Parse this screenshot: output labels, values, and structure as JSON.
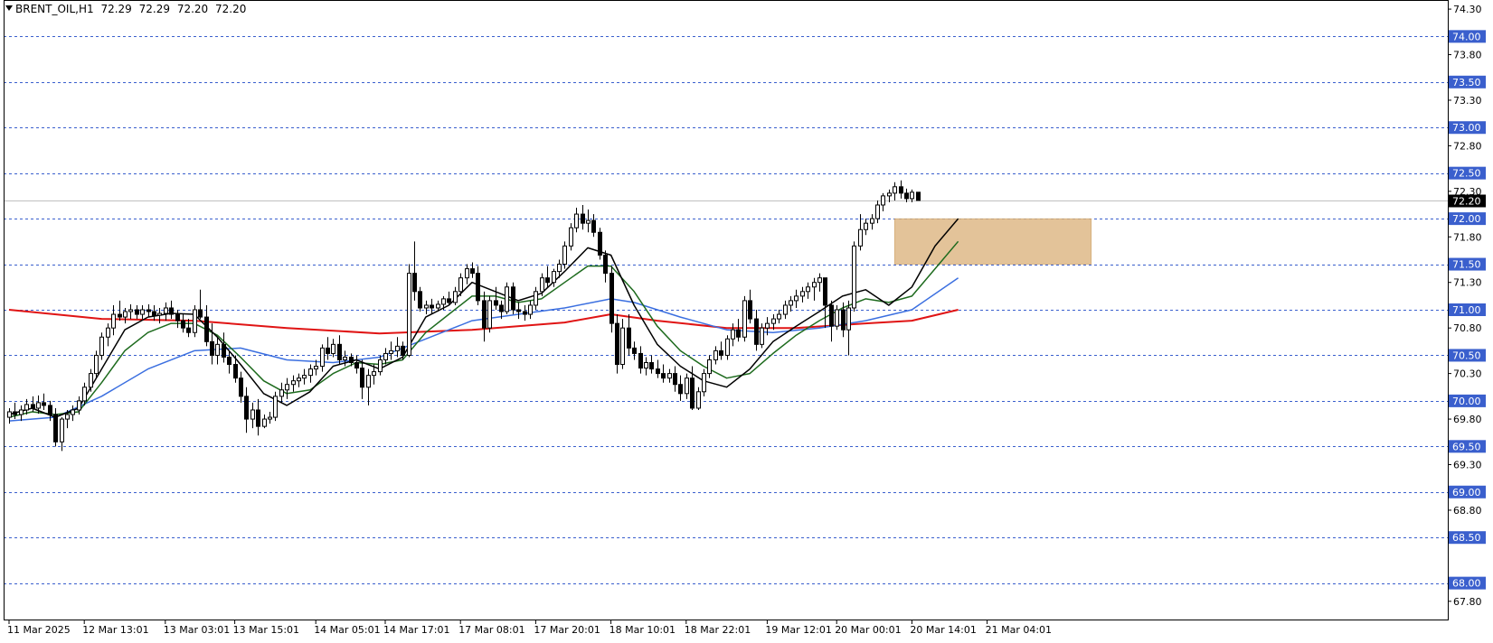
{
  "header": {
    "symbol": "BRENT_OIL,H1",
    "open": "72.29",
    "high": "72.29",
    "low": "72.20",
    "close": "72.20"
  },
  "colors": {
    "background": "#ffffff",
    "grid_level": "#3a5fcd",
    "label_box": "#3a5fcd",
    "price_box": "#000000",
    "bull_candle": "#ffffff",
    "bear_candle": "#000000",
    "ma_fast": "#000000",
    "ma_mid": "#1e6b1e",
    "ma_slow": "#3b6fe0",
    "ma_long": "#e01414",
    "zone": "#deb887"
  },
  "chart_data": {
    "type": "candlestick",
    "timeframe": "H1",
    "ylim": [
      67.6,
      74.4
    ],
    "y_ticks": [
      "74.30",
      "73.80",
      "73.30",
      "72.80",
      "72.30",
      "71.80",
      "71.30",
      "70.80",
      "70.30",
      "69.80",
      "69.30",
      "68.80",
      "67.80"
    ],
    "level_labels": [
      "74.00",
      "73.50",
      "73.00",
      "72.50",
      "72.00",
      "71.50",
      "71.00",
      "70.50",
      "70.00",
      "69.50",
      "69.00",
      "68.50",
      "68.00"
    ],
    "level_values": [
      74.0,
      73.5,
      73.0,
      72.5,
      72.0,
      71.5,
      71.0,
      70.5,
      70.0,
      69.5,
      69.0,
      68.5,
      68.0
    ],
    "current_price": "72.20",
    "x_labels": [
      "11 Mar 2025",
      "12 Mar 13:01",
      "13 Mar 03:01",
      "13 Mar 15:01",
      "14 Mar 05:01",
      "14 Mar 17:01",
      "17 Mar 08:01",
      "17 Mar 20:01",
      "18 Mar 10:01",
      "18 Mar 22:01",
      "19 Mar 12:01",
      "20 Mar 00:01",
      "20 Mar 14:01",
      "21 Mar 04:01"
    ],
    "x_label_bars": [
      0,
      13,
      27,
      39,
      53,
      65,
      78,
      91,
      104,
      117,
      131,
      143,
      156,
      169
    ],
    "zone": {
      "bar_from": 153,
      "bar_to": 187,
      "from": 71.5,
      "to": 72.0
    },
    "ohlc": [
      [
        69.82,
        69.92,
        69.75,
        69.88
      ],
      [
        69.88,
        69.98,
        69.8,
        69.85
      ],
      [
        69.85,
        69.95,
        69.78,
        69.9
      ],
      [
        69.9,
        70.02,
        69.85,
        69.96
      ],
      [
        69.96,
        70.05,
        69.88,
        69.92
      ],
      [
        69.92,
        70.06,
        69.86,
        69.98
      ],
      [
        69.98,
        70.08,
        69.9,
        69.95
      ],
      [
        69.95,
        70.0,
        69.78,
        69.85
      ],
      [
        69.85,
        69.92,
        69.5,
        69.55
      ],
      [
        69.55,
        69.82,
        69.45,
        69.8
      ],
      [
        69.8,
        69.9,
        69.7,
        69.85
      ],
      [
        69.85,
        69.95,
        69.78,
        69.9
      ],
      [
        69.9,
        70.05,
        69.85,
        70.0
      ],
      [
        70.0,
        70.2,
        69.95,
        70.15
      ],
      [
        70.15,
        70.35,
        70.1,
        70.3
      ],
      [
        70.3,
        70.55,
        70.25,
        70.5
      ],
      [
        70.5,
        70.75,
        70.45,
        70.7
      ],
      [
        70.7,
        70.85,
        70.6,
        70.8
      ],
      [
        70.8,
        71.05,
        70.72,
        70.95
      ],
      [
        70.95,
        71.1,
        70.88,
        70.92
      ],
      [
        70.92,
        71.02,
        70.85,
        70.98
      ],
      [
        70.98,
        71.06,
        70.9,
        71.0
      ],
      [
        71.0,
        71.05,
        70.9,
        70.95
      ],
      [
        70.95,
        71.05,
        70.9,
        71.0
      ],
      [
        71.0,
        71.06,
        70.92,
        70.98
      ],
      [
        70.98,
        71.05,
        70.88,
        70.94
      ],
      [
        70.94,
        71.02,
        70.85,
        70.96
      ],
      [
        70.96,
        71.08,
        70.88,
        71.02
      ],
      [
        71.02,
        71.1,
        70.9,
        70.95
      ],
      [
        70.95,
        71.0,
        70.8,
        70.88
      ],
      [
        70.88,
        70.95,
        70.75,
        70.8
      ],
      [
        70.8,
        70.9,
        70.7,
        70.75
      ],
      [
        70.75,
        71.05,
        70.7,
        71.0
      ],
      [
        71.0,
        71.22,
        70.9,
        70.92
      ],
      [
        70.92,
        71.05,
        70.6,
        70.65
      ],
      [
        70.65,
        70.85,
        70.4,
        70.5
      ],
      [
        70.5,
        70.7,
        70.4,
        70.62
      ],
      [
        70.62,
        70.75,
        70.42,
        70.48
      ],
      [
        70.48,
        70.55,
        70.3,
        70.4
      ],
      [
        70.4,
        70.5,
        70.2,
        70.25
      ],
      [
        70.25,
        70.32,
        69.98,
        70.05
      ],
      [
        70.05,
        70.15,
        69.65,
        69.8
      ],
      [
        69.8,
        69.98,
        69.7,
        69.9
      ],
      [
        69.9,
        70.02,
        69.62,
        69.72
      ],
      [
        69.72,
        69.85,
        69.7,
        69.8
      ],
      [
        69.8,
        69.88,
        69.75,
        69.82
      ],
      [
        69.82,
        70.1,
        69.78,
        70.05
      ],
      [
        70.05,
        70.2,
        69.98,
        70.12
      ],
      [
        70.12,
        70.25,
        70.02,
        70.18
      ],
      [
        70.18,
        70.28,
        70.1,
        70.22
      ],
      [
        70.22,
        70.3,
        70.15,
        70.25
      ],
      [
        70.25,
        70.35,
        70.18,
        70.28
      ],
      [
        70.28,
        70.4,
        70.2,
        70.35
      ],
      [
        70.35,
        70.45,
        70.28,
        70.38
      ],
      [
        70.38,
        70.62,
        70.32,
        70.58
      ],
      [
        70.58,
        70.7,
        70.45,
        70.52
      ],
      [
        70.52,
        70.68,
        70.48,
        70.62
      ],
      [
        70.62,
        70.72,
        70.4,
        70.45
      ],
      [
        70.45,
        70.55,
        70.38,
        70.48
      ],
      [
        70.48,
        70.52,
        70.38,
        70.42
      ],
      [
        70.42,
        70.5,
        70.3,
        70.36
      ],
      [
        70.36,
        70.45,
        70.02,
        70.15
      ],
      [
        70.15,
        70.35,
        69.95,
        70.28
      ],
      [
        70.28,
        70.4,
        70.18,
        70.32
      ],
      [
        70.32,
        70.5,
        70.28,
        70.45
      ],
      [
        70.45,
        70.58,
        70.4,
        70.52
      ],
      [
        70.52,
        70.65,
        70.45,
        70.55
      ],
      [
        70.55,
        70.7,
        70.48,
        70.6
      ],
      [
        70.6,
        70.65,
        70.45,
        70.5
      ],
      [
        70.5,
        71.5,
        70.48,
        71.4
      ],
      [
        71.4,
        71.75,
        71.1,
        71.2
      ],
      [
        71.2,
        71.25,
        70.98,
        71.02
      ],
      [
        71.02,
        71.1,
        70.95,
        71.05
      ],
      [
        71.05,
        71.12,
        70.95,
        71.02
      ],
      [
        71.02,
        71.1,
        70.98,
        71.06
      ],
      [
        71.06,
        71.15,
        71.0,
        71.12
      ],
      [
        71.12,
        71.2,
        71.05,
        71.08
      ],
      [
        71.08,
        71.25,
        71.05,
        71.2
      ],
      [
        71.2,
        71.4,
        71.15,
        71.35
      ],
      [
        71.35,
        71.5,
        71.28,
        71.45
      ],
      [
        71.45,
        71.52,
        71.35,
        71.4
      ],
      [
        71.4,
        71.48,
        71.05,
        71.1
      ],
      [
        71.1,
        71.2,
        70.65,
        70.8
      ],
      [
        70.8,
        71.15,
        70.75,
        71.1
      ],
      [
        71.1,
        71.25,
        71.0,
        71.05
      ],
      [
        71.05,
        71.1,
        70.9,
        70.98
      ],
      [
        70.98,
        71.3,
        70.95,
        71.25
      ],
      [
        71.25,
        71.3,
        70.95,
        71.0
      ],
      [
        71.0,
        71.08,
        70.9,
        70.98
      ],
      [
        70.98,
        71.05,
        70.88,
        70.95
      ],
      [
        70.95,
        71.1,
        70.9,
        71.05
      ],
      [
        71.05,
        71.25,
        71.0,
        71.2
      ],
      [
        71.2,
        71.4,
        71.15,
        71.35
      ],
      [
        71.35,
        71.48,
        71.25,
        71.3
      ],
      [
        71.3,
        71.45,
        71.25,
        71.42
      ],
      [
        71.42,
        71.55,
        71.35,
        71.5
      ],
      [
        71.5,
        71.75,
        71.45,
        71.7
      ],
      [
        71.7,
        71.95,
        71.65,
        71.9
      ],
      [
        71.9,
        72.12,
        71.85,
        72.05
      ],
      [
        72.05,
        72.15,
        71.88,
        71.95
      ],
      [
        71.95,
        72.1,
        71.85,
        71.98
      ],
      [
        71.98,
        72.05,
        71.8,
        71.85
      ],
      [
        71.85,
        71.9,
        71.55,
        71.6
      ],
      [
        71.6,
        71.65,
        71.3,
        71.4
      ],
      [
        71.4,
        71.48,
        70.75,
        70.85
      ],
      [
        70.85,
        70.95,
        70.3,
        70.4
      ],
      [
        70.4,
        70.9,
        70.35,
        70.8
      ],
      [
        70.8,
        70.95,
        70.5,
        70.58
      ],
      [
        70.58,
        70.65,
        70.45,
        70.52
      ],
      [
        70.52,
        70.6,
        70.3,
        70.36
      ],
      [
        70.36,
        70.48,
        70.28,
        70.42
      ],
      [
        70.42,
        70.5,
        70.3,
        70.35
      ],
      [
        70.35,
        70.45,
        70.25,
        70.3
      ],
      [
        70.3,
        70.4,
        70.2,
        70.25
      ],
      [
        70.25,
        70.35,
        70.2,
        70.3
      ],
      [
        70.3,
        70.38,
        70.1,
        70.18
      ],
      [
        70.18,
        70.28,
        70.0,
        70.08
      ],
      [
        70.08,
        70.3,
        70.02,
        70.25
      ],
      [
        70.25,
        70.38,
        69.9,
        69.92
      ],
      [
        69.92,
        70.15,
        69.9,
        70.1
      ],
      [
        70.1,
        70.35,
        70.05,
        70.3
      ],
      [
        70.3,
        70.5,
        70.25,
        70.45
      ],
      [
        70.45,
        70.6,
        70.4,
        70.55
      ],
      [
        70.55,
        70.65,
        70.45,
        70.5
      ],
      [
        70.5,
        70.72,
        70.45,
        70.68
      ],
      [
        70.68,
        70.85,
        70.6,
        70.78
      ],
      [
        70.78,
        70.9,
        70.65,
        70.7
      ],
      [
        70.7,
        71.15,
        70.65,
        71.1
      ],
      [
        71.1,
        71.22,
        70.85,
        70.9
      ],
      [
        70.9,
        71.0,
        70.55,
        70.62
      ],
      [
        70.62,
        70.85,
        70.58,
        70.8
      ],
      [
        70.8,
        70.92,
        70.72,
        70.85
      ],
      [
        70.85,
        70.95,
        70.78,
        70.9
      ],
      [
        70.9,
        71.0,
        70.85,
        70.95
      ],
      [
        70.95,
        71.1,
        70.9,
        71.05
      ],
      [
        71.05,
        71.15,
        70.98,
        71.1
      ],
      [
        71.1,
        71.22,
        71.02,
        71.15
      ],
      [
        71.15,
        71.25,
        71.08,
        71.2
      ],
      [
        71.2,
        71.3,
        71.12,
        71.25
      ],
      [
        71.25,
        71.35,
        71.1,
        71.3
      ],
      [
        71.3,
        71.4,
        71.2,
        71.35
      ],
      [
        71.35,
        71.2,
        70.8,
        71.05
      ],
      [
        71.05,
        71.1,
        70.65,
        70.82
      ],
      [
        70.82,
        71.05,
        70.78,
        71.0
      ],
      [
        71.0,
        71.08,
        70.7,
        70.78
      ],
      [
        70.78,
        71.1,
        70.5,
        71.02
      ],
      [
        71.02,
        71.75,
        70.98,
        71.7
      ],
      [
        71.7,
        72.05,
        71.65,
        71.88
      ],
      [
        71.88,
        72.0,
        71.82,
        71.95
      ],
      [
        71.95,
        72.05,
        71.88,
        72.0
      ],
      [
        72.0,
        72.2,
        71.95,
        72.15
      ],
      [
        72.15,
        72.28,
        72.08,
        72.25
      ],
      [
        72.25,
        72.32,
        72.18,
        72.28
      ],
      [
        72.28,
        72.4,
        72.2,
        72.35
      ],
      [
        72.35,
        72.42,
        72.22,
        72.28
      ],
      [
        72.28,
        72.33,
        72.18,
        72.22
      ],
      [
        72.22,
        72.32,
        72.18,
        72.29
      ],
      [
        72.29,
        72.29,
        72.2,
        72.2
      ]
    ],
    "ma_fast": [
      [
        0,
        69.85
      ],
      [
        4,
        69.92
      ],
      [
        8,
        69.82
      ],
      [
        12,
        69.92
      ],
      [
        16,
        70.35
      ],
      [
        20,
        70.78
      ],
      [
        24,
        70.92
      ],
      [
        28,
        70.96
      ],
      [
        32,
        70.95
      ],
      [
        36,
        70.7
      ],
      [
        40,
        70.4
      ],
      [
        44,
        70.08
      ],
      [
        48,
        69.95
      ],
      [
        52,
        70.1
      ],
      [
        56,
        70.38
      ],
      [
        60,
        70.45
      ],
      [
        64,
        70.35
      ],
      [
        68,
        70.48
      ],
      [
        72,
        70.92
      ],
      [
        76,
        71.05
      ],
      [
        80,
        71.3
      ],
      [
        84,
        71.2
      ],
      [
        88,
        71.1
      ],
      [
        92,
        71.18
      ],
      [
        96,
        71.42
      ],
      [
        100,
        71.68
      ],
      [
        104,
        71.6
      ],
      [
        108,
        71.05
      ],
      [
        112,
        70.62
      ],
      [
        116,
        70.38
      ],
      [
        120,
        70.22
      ],
      [
        124,
        70.15
      ],
      [
        128,
        70.35
      ],
      [
        132,
        70.65
      ],
      [
        136,
        70.82
      ],
      [
        140,
        70.98
      ],
      [
        144,
        71.15
      ],
      [
        148,
        71.22
      ],
      [
        152,
        71.05
      ],
      [
        156,
        71.25
      ],
      [
        160,
        71.7
      ],
      [
        164,
        72.0
      ]
    ],
    "ma_mid": [
      [
        0,
        69.82
      ],
      [
        4,
        69.88
      ],
      [
        8,
        69.85
      ],
      [
        12,
        69.88
      ],
      [
        16,
        70.2
      ],
      [
        20,
        70.55
      ],
      [
        24,
        70.75
      ],
      [
        28,
        70.85
      ],
      [
        32,
        70.85
      ],
      [
        36,
        70.72
      ],
      [
        40,
        70.48
      ],
      [
        44,
        70.22
      ],
      [
        48,
        70.08
      ],
      [
        52,
        70.12
      ],
      [
        56,
        70.3
      ],
      [
        60,
        70.42
      ],
      [
        64,
        70.4
      ],
      [
        68,
        70.45
      ],
      [
        72,
        70.75
      ],
      [
        76,
        70.95
      ],
      [
        80,
        71.15
      ],
      [
        84,
        71.15
      ],
      [
        88,
        71.08
      ],
      [
        92,
        71.12
      ],
      [
        96,
        71.3
      ],
      [
        100,
        71.48
      ],
      [
        104,
        71.48
      ],
      [
        108,
        71.2
      ],
      [
        112,
        70.82
      ],
      [
        116,
        70.55
      ],
      [
        120,
        70.38
      ],
      [
        124,
        70.25
      ],
      [
        128,
        70.3
      ],
      [
        132,
        70.52
      ],
      [
        136,
        70.72
      ],
      [
        140,
        70.88
      ],
      [
        144,
        71.02
      ],
      [
        148,
        71.12
      ],
      [
        152,
        71.08
      ],
      [
        156,
        71.15
      ],
      [
        160,
        71.45
      ],
      [
        164,
        71.75
      ]
    ],
    "ma_slow": [
      [
        0,
        69.78
      ],
      [
        8,
        69.82
      ],
      [
        16,
        70.05
      ],
      [
        24,
        70.35
      ],
      [
        32,
        70.55
      ],
      [
        40,
        70.58
      ],
      [
        48,
        70.45
      ],
      [
        56,
        70.42
      ],
      [
        64,
        70.48
      ],
      [
        72,
        70.68
      ],
      [
        80,
        70.88
      ],
      [
        88,
        70.95
      ],
      [
        96,
        71.02
      ],
      [
        104,
        71.12
      ],
      [
        108,
        71.08
      ],
      [
        116,
        70.92
      ],
      [
        124,
        70.78
      ],
      [
        132,
        70.75
      ],
      [
        140,
        70.8
      ],
      [
        148,
        70.88
      ],
      [
        156,
        71.0
      ],
      [
        164,
        71.35
      ]
    ],
    "ma_long": [
      [
        0,
        71.0
      ],
      [
        16,
        70.9
      ],
      [
        32,
        70.88
      ],
      [
        48,
        70.8
      ],
      [
        64,
        70.74
      ],
      [
        80,
        70.78
      ],
      [
        96,
        70.86
      ],
      [
        104,
        70.95
      ],
      [
        112,
        70.88
      ],
      [
        124,
        70.8
      ],
      [
        136,
        70.8
      ],
      [
        148,
        70.85
      ],
      [
        156,
        70.88
      ],
      [
        164,
        71.0
      ]
    ]
  }
}
